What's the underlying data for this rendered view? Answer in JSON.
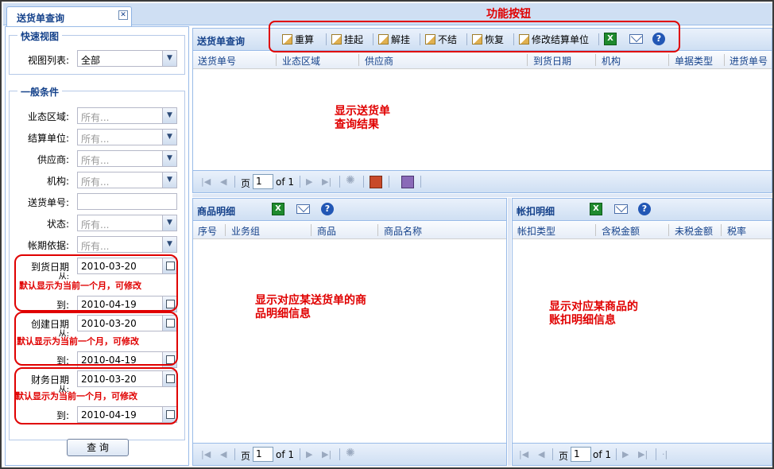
{
  "tab": {
    "title": "送货单查询",
    "close": "✕"
  },
  "left": {
    "quick_view": {
      "legend": "快速视图",
      "view_list_label": "视图列表:",
      "view_list_value": "全部"
    },
    "general": {
      "legend": "一般条件",
      "business_area_label": "业态区域:",
      "settle_unit_label": "结算单位:",
      "supplier_label": "供应商:",
      "org_label": "机构:",
      "delivery_no_label": "送货单号:",
      "status_label": "状态:",
      "account_basis_label": "帐期依据:",
      "placeholder": "所有..."
    },
    "arrival": {
      "label": "到货日期",
      "from_label": "从:",
      "from": "2010-03-20",
      "to_label": "到:",
      "to": "2010-04-19"
    },
    "created": {
      "label": "创建日期",
      "from_label": "从:",
      "from": "2010-03-20",
      "to_label": "到:",
      "to": "2010-04-19"
    },
    "finance": {
      "label": "财务日期",
      "from_label": "从:",
      "from": "2010-03-20",
      "to_label": "到:",
      "to": "2010-04-19"
    },
    "date_note": "默认显示为当前一个月，可修改",
    "query_button": "查 询"
  },
  "func_label": "功能按钮",
  "top": {
    "title": "送货单查询",
    "toolbar": [
      "重算",
      "挂起",
      "解挂",
      "不结",
      "恢复",
      "修改结算单位"
    ],
    "columns": [
      "送货单号",
      "业态区域",
      "供应商",
      "到货日期",
      "机构",
      "单据类型",
      "进货单号"
    ],
    "note": [
      "显示送货单",
      "查询结果"
    ],
    "pager": {
      "page_label": "页",
      "page": "1",
      "of": "of 1"
    }
  },
  "goods": {
    "title": "商品明细",
    "columns": [
      "序号",
      "业务组",
      "商品",
      "商品名称"
    ],
    "note": [
      "显示对应某送货单的商",
      "品明细信息"
    ],
    "pager": {
      "page_label": "页",
      "page": "1",
      "of": "of 1"
    }
  },
  "deduct": {
    "title": "帐扣明细",
    "columns": [
      "帐扣类型",
      "含税金额",
      "未税金额",
      "税率"
    ],
    "note": [
      "显示对应某商品的",
      "账扣明细信息"
    ],
    "pager": {
      "page_label": "页",
      "page": "1",
      "of": "of 1"
    }
  },
  "icons": {
    "excel": "X",
    "help": "?"
  },
  "colors": {
    "accent": "#15428b",
    "annotation": "#e00000",
    "header_bg": "#cfdff3"
  }
}
